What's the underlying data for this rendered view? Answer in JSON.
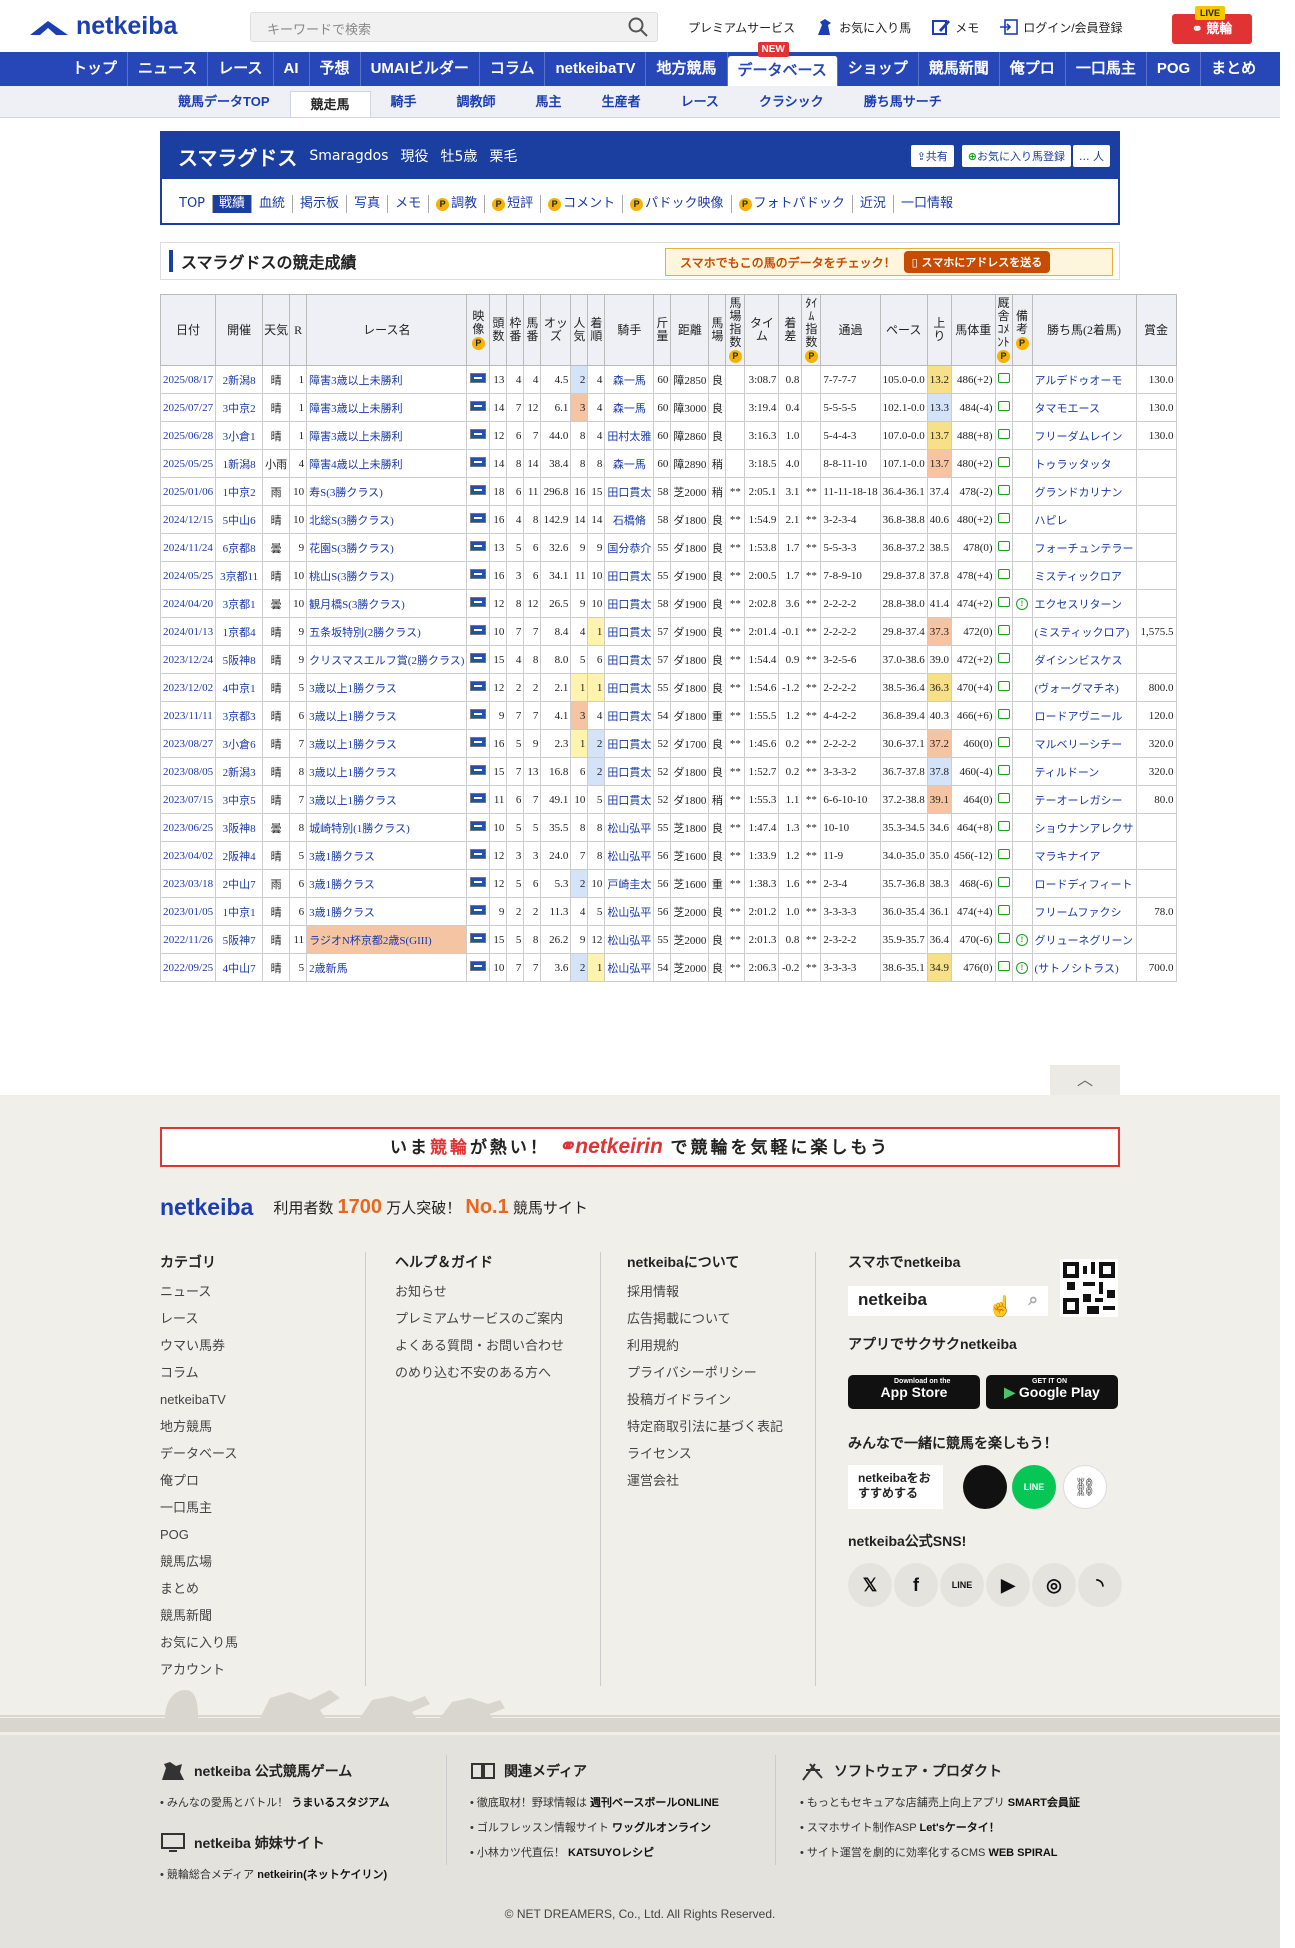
{
  "header": {
    "logo": "netkeiba",
    "search_placeholder": "キーワードで検索",
    "links": [
      "プレミアムサービス",
      "お気に入り馬",
      "メモ",
      "ログイン/会員登録"
    ],
    "live_badge": "LIVE",
    "live_label": "競輪"
  },
  "gnav": {
    "items": [
      "トップ",
      "ニュース",
      "レース",
      "AI",
      "予想",
      "UMAIビルダー",
      "コラム",
      "netkeibaTV",
      "地方競馬",
      "データベース",
      "ショップ",
      "競馬新聞",
      "俺プロ",
      "一口馬主",
      "POG",
      "まとめ"
    ],
    "new_badge": "NEW"
  },
  "snav": {
    "items": [
      "競馬データTOP",
      "競走馬",
      "騎手",
      "調教師",
      "馬主",
      "生産者",
      "レース",
      "クラシック",
      "勝ち馬サーチ"
    ]
  },
  "horse": {
    "name": "スマラグドス",
    "name_en": "Smaragdos",
    "status": "現役",
    "sex_age": "牡5歳",
    "color": "栗毛",
    "share": "共有",
    "fav": "お気に入り馬登録",
    "people": "... 人",
    "tabs": [
      "TOP",
      "戦績",
      "血統",
      "掲示板",
      "写真",
      "メモ",
      "調教",
      "短評",
      "コメント",
      "パドック映像",
      "フォトパドック",
      "近況",
      "一口情報"
    ]
  },
  "section": {
    "title": "スマラグドスの競走成績",
    "promo": "スマホでもこの馬のデータをチェック！",
    "promo_btn": "スマホにアドレスを送る"
  },
  "table": {
    "headers": [
      "日付",
      "開催",
      "天気",
      "R",
      "レース名",
      "映像",
      "頭数",
      "枠番",
      "馬番",
      "オッズ",
      "人気",
      "着順",
      "騎手",
      "斤量",
      "距離",
      "馬場",
      "馬場指数",
      "タイム",
      "着差",
      "ﾀｲﾑ指数",
      "通過",
      "ペース",
      "上り",
      "馬体重",
      "厩舎ｺﾒﾝﾄ",
      "備考",
      "勝ち馬(2着馬)",
      "賞金"
    ],
    "rows": [
      [
        "2025/08/17",
        "2新潟8",
        "晴",
        "1",
        "障害3歳以上未勝利",
        "13",
        "4",
        "4",
        "4.5",
        "2",
        "4",
        "森一馬",
        "60",
        "障2850",
        "良",
        "",
        "3:08.7",
        "0.8",
        "",
        "7-7-7-7",
        "105.0-0.0",
        "13.2",
        "486(+2)",
        "c",
        "",
        "アルデドゥオーモ",
        "130.0"
      ],
      [
        "2025/07/27",
        "3中京2",
        "晴",
        "1",
        "障害3歳以上未勝利",
        "14",
        "7",
        "12",
        "6.1",
        "3",
        "4",
        "森一馬",
        "60",
        "障3000",
        "良",
        "",
        "3:19.4",
        "0.4",
        "",
        "5-5-5-5",
        "102.1-0.0",
        "13.3",
        "484(-4)",
        "c",
        "",
        "タマモエース",
        "130.0"
      ],
      [
        "2025/06/28",
        "3小倉1",
        "晴",
        "1",
        "障害3歳以上未勝利",
        "12",
        "6",
        "7",
        "44.0",
        "8",
        "4",
        "田村太雅",
        "60",
        "障2860",
        "良",
        "",
        "3:16.3",
        "1.0",
        "",
        "5-4-4-3",
        "107.0-0.0",
        "13.7",
        "488(+8)",
        "c",
        "",
        "フリーダムレイン",
        "130.0"
      ],
      [
        "2025/05/25",
        "1新潟8",
        "小雨",
        "4",
        "障害4歳以上未勝利",
        "14",
        "8",
        "14",
        "38.4",
        "8",
        "8",
        "森一馬",
        "60",
        "障2890",
        "稍",
        "",
        "3:18.5",
        "4.0",
        "",
        "8-8-11-10",
        "107.1-0.0",
        "13.7",
        "480(+2)",
        "c",
        "",
        "トゥラッタッタ",
        ""
      ],
      [
        "2025/01/06",
        "1中京2",
        "雨",
        "10",
        "寿S(3勝クラス)",
        "18",
        "6",
        "11",
        "296.8",
        "16",
        "15",
        "田口貫太",
        "58",
        "芝2000",
        "稍",
        "**",
        "2:05.1",
        "3.1",
        "**",
        "11-11-18-18",
        "36.4-36.1",
        "37.4",
        "478(-2)",
        "c",
        "",
        "グランドカリナン",
        ""
      ],
      [
        "2024/12/15",
        "5中山6",
        "晴",
        "10",
        "北総S(3勝クラス)",
        "16",
        "4",
        "8",
        "142.9",
        "14",
        "14",
        "石橋脩",
        "58",
        "ダ1800",
        "良",
        "**",
        "1:54.9",
        "2.1",
        "**",
        "3-2-3-4",
        "36.8-38.8",
        "40.6",
        "480(+2)",
        "c",
        "",
        "ハピレ",
        ""
      ],
      [
        "2024/11/24",
        "6京都8",
        "曇",
        "9",
        "花園S(3勝クラス)",
        "13",
        "5",
        "6",
        "32.6",
        "9",
        "9",
        "国分恭介",
        "55",
        "ダ1800",
        "良",
        "**",
        "1:53.8",
        "1.7",
        "**",
        "5-5-3-3",
        "36.8-37.2",
        "38.5",
        "478(0)",
        "c",
        "",
        "フォーチュンテラー",
        ""
      ],
      [
        "2024/05/25",
        "3京都11",
        "晴",
        "10",
        "桃山S(3勝クラス)",
        "16",
        "3",
        "6",
        "34.1",
        "11",
        "10",
        "田口貫太",
        "55",
        "ダ1900",
        "良",
        "**",
        "2:00.5",
        "1.7",
        "**",
        "7-8-9-10",
        "29.8-37.8",
        "37.8",
        "478(+4)",
        "c",
        "",
        "ミスティックロア",
        ""
      ],
      [
        "2024/04/20",
        "3京都1",
        "曇",
        "10",
        "観月橋S(3勝クラス)",
        "12",
        "8",
        "12",
        "26.5",
        "9",
        "10",
        "田口貫太",
        "58",
        "ダ1900",
        "良",
        "**",
        "2:02.8",
        "3.6",
        "**",
        "2-2-2-2",
        "28.8-38.0",
        "41.4",
        "474(+2)",
        "c",
        "e",
        "エクセスリターン",
        ""
      ],
      [
        "2024/01/13",
        "1京都4",
        "晴",
        "9",
        "五条坂特別(2勝クラス)",
        "10",
        "7",
        "7",
        "8.4",
        "4",
        "1",
        "田口貫太",
        "57",
        "ダ1900",
        "良",
        "**",
        "2:01.4",
        "-0.1",
        "**",
        "2-2-2-2",
        "29.8-37.4",
        "37.3",
        "472(0)",
        "c",
        "",
        "(ミスティックロア)",
        "1,575.5"
      ],
      [
        "2023/12/24",
        "5阪神8",
        "晴",
        "9",
        "クリスマスエルフ賞(2勝クラス)",
        "15",
        "4",
        "8",
        "8.0",
        "5",
        "6",
        "田口貫太",
        "57",
        "ダ1800",
        "良",
        "**",
        "1:54.4",
        "0.9",
        "**",
        "3-2-5-6",
        "37.0-38.6",
        "39.0",
        "472(+2)",
        "c",
        "",
        "ダイシンビスケス",
        ""
      ],
      [
        "2023/12/02",
        "4中京1",
        "晴",
        "5",
        "3歳以上1勝クラス",
        "12",
        "2",
        "2",
        "2.1",
        "1",
        "1",
        "田口貫太",
        "55",
        "ダ1800",
        "良",
        "**",
        "1:54.6",
        "-1.2",
        "**",
        "2-2-2-2",
        "38.5-36.4",
        "36.3",
        "470(+4)",
        "c",
        "",
        "(ヴォーグマチネ)",
        "800.0"
      ],
      [
        "2023/11/11",
        "3京都3",
        "晴",
        "6",
        "3歳以上1勝クラス",
        "9",
        "7",
        "7",
        "4.1",
        "3",
        "4",
        "田口貫太",
        "54",
        "ダ1800",
        "重",
        "**",
        "1:55.5",
        "1.2",
        "**",
        "4-4-2-2",
        "36.8-39.4",
        "40.3",
        "466(+6)",
        "c",
        "",
        "ロードアヴニール",
        "120.0"
      ],
      [
        "2023/08/27",
        "3小倉6",
        "晴",
        "7",
        "3歳以上1勝クラス",
        "16",
        "5",
        "9",
        "2.3",
        "1",
        "2",
        "田口貫太",
        "52",
        "ダ1700",
        "良",
        "**",
        "1:45.6",
        "0.2",
        "**",
        "2-2-2-2",
        "30.6-37.1",
        "37.2",
        "460(0)",
        "c",
        "",
        "マルベリーシチー",
        "320.0"
      ],
      [
        "2023/08/05",
        "2新潟3",
        "晴",
        "8",
        "3歳以上1勝クラス",
        "15",
        "7",
        "13",
        "16.8",
        "6",
        "2",
        "田口貫太",
        "52",
        "ダ1800",
        "良",
        "**",
        "1:52.7",
        "0.2",
        "**",
        "3-3-3-2",
        "36.7-37.8",
        "37.8",
        "460(-4)",
        "c",
        "",
        "ティルドーン",
        "320.0"
      ],
      [
        "2023/07/15",
        "3中京5",
        "晴",
        "7",
        "3歳以上1勝クラス",
        "11",
        "6",
        "7",
        "49.1",
        "10",
        "5",
        "田口貫太",
        "52",
        "ダ1800",
        "稍",
        "**",
        "1:55.3",
        "1.1",
        "**",
        "6-6-10-10",
        "37.2-38.8",
        "39.1",
        "464(0)",
        "c",
        "",
        "テーオーレガシー",
        "80.0"
      ],
      [
        "2023/06/25",
        "3阪神8",
        "曇",
        "8",
        "城崎特別(1勝クラス)",
        "10",
        "5",
        "5",
        "35.5",
        "8",
        "8",
        "松山弘平",
        "55",
        "芝1800",
        "良",
        "**",
        "1:47.4",
        "1.3",
        "**",
        "10-10",
        "35.3-34.5",
        "34.6",
        "464(+8)",
        "c",
        "",
        "ショウナンアレクサ",
        ""
      ],
      [
        "2023/04/02",
        "2阪神4",
        "晴",
        "5",
        "3歳1勝クラス",
        "12",
        "3",
        "3",
        "24.0",
        "7",
        "8",
        "松山弘平",
        "56",
        "芝1600",
        "良",
        "**",
        "1:33.9",
        "1.2",
        "**",
        "11-9",
        "34.0-35.0",
        "35.0",
        "456(-12)",
        "c",
        "",
        "マラキナイア",
        ""
      ],
      [
        "2023/03/18",
        "2中山7",
        "雨",
        "6",
        "3歳1勝クラス",
        "12",
        "5",
        "6",
        "5.3",
        "2",
        "10",
        "戸崎圭太",
        "56",
        "芝1600",
        "重",
        "**",
        "1:38.3",
        "1.6",
        "**",
        "2-3-4",
        "35.7-36.8",
        "38.3",
        "468(-6)",
        "c",
        "",
        "ロードディフィート",
        ""
      ],
      [
        "2023/01/05",
        "1中京1",
        "晴",
        "6",
        "3歳1勝クラス",
        "9",
        "2",
        "2",
        "11.3",
        "4",
        "5",
        "松山弘平",
        "56",
        "芝2000",
        "良",
        "**",
        "2:01.2",
        "1.0",
        "**",
        "3-3-3-3",
        "36.0-35.4",
        "36.1",
        "474(+4)",
        "c",
        "",
        "フリームファクシ",
        "78.0"
      ],
      [
        "2022/11/26",
        "5阪神7",
        "晴",
        "11",
        "ラジオN杯京都2歳S(GIII)",
        "15",
        "5",
        "8",
        "26.2",
        "9",
        "12",
        "松山弘平",
        "55",
        "芝2000",
        "良",
        "**",
        "2:01.3",
        "0.8",
        "**",
        "2-3-2-2",
        "35.9-35.7",
        "36.4",
        "470(-6)",
        "c",
        "e",
        "グリューネグリーン",
        ""
      ],
      [
        "2022/09/25",
        "4中山7",
        "晴",
        "5",
        "2歳新馬",
        "10",
        "7",
        "7",
        "3.6",
        "2",
        "1",
        "松山弘平",
        "54",
        "芝2000",
        "良",
        "**",
        "2:06.3",
        "-0.2",
        "**",
        "3-3-3-3",
        "38.6-35.1",
        "34.9",
        "476(0)",
        "c",
        "e",
        "(サトノシトラス)",
        "700.0"
      ]
    ]
  },
  "footer": {
    "keirin_pre": "いま",
    "keirin_red": "競輪",
    "keirin_mid": "が熱い！",
    "keirin_logo": "netkeirin",
    "keirin_post": "で競輪を気軽に楽しもう",
    "brand": "netkeiba",
    "brand_pre": "利用者数",
    "brand_num": "1700",
    "brand_mid": "万人突破！",
    "brand_no1": "No.1",
    "brand_post": "競馬サイト",
    "col1": {
      "title": "カテゴリ",
      "items": [
        "ニュース",
        "レース",
        "ウマい馬券",
        "コラム",
        "netkeibaTV",
        "地方競馬",
        "データベース",
        "俺プロ",
        "一口馬主",
        "POG",
        "競馬広場",
        "まとめ",
        "競馬新聞",
        "お気に入り馬",
        "アカウント"
      ]
    },
    "col2": {
      "title": "ヘルプ＆ガイド",
      "items": [
        "お知らせ",
        "プレミアムサービスのご案内",
        "よくある質問・お問い合わせ",
        "のめり込む不安のある方へ"
      ]
    },
    "col3": {
      "title": "netkeibaについて",
      "items": [
        "採用情報",
        "広告掲載について",
        "利用規約",
        "プライバシーポリシー",
        "投稿ガイドライン",
        "特定商取引法に基づく表記",
        "ライセンス",
        "運営会社"
      ]
    },
    "col4": {
      "title": "スマホでnetkeiba",
      "search": "netkeiba",
      "app_title": "アプリでサクサクnetkeiba",
      "appstore": "App Store",
      "appstore_small": "Download on the",
      "googleplay": "Google Play",
      "googleplay_small": "GET IT ON",
      "share_title": "みんなで一緒に競馬を楽しもう！",
      "recommend": "netkeibaをおすすめする",
      "line": "LINE",
      "sns_title": "netkeiba公式SNS!"
    },
    "lower": {
      "game_title": "netkeiba 公式競馬ゲーム",
      "game_item": "みんなの愛馬とバトル！",
      "game_item_b": "うまいるスタジアム",
      "sister_title": "netkeiba 姉妹サイト",
      "sister_item": "競輪総合メディア",
      "sister_item_b": "netkeirin(ネットケイリン)",
      "media_title": "関連メディア",
      "media_items": [
        [
          "徹底取材！野球情報は",
          "週刊ベースボールONLINE"
        ],
        [
          "ゴルフレッスン情報サイト",
          "ワッグルオンライン"
        ],
        [
          "小林カツ代直伝！",
          "KATSUYOレシピ"
        ]
      ],
      "soft_title": "ソフトウェア・プロダクト",
      "soft_items": [
        [
          "もっともセキュアな店舗売上向上アプリ",
          "SMART会員証"
        ],
        [
          "スマホサイト制作ASP",
          "Let'sケータイ！"
        ],
        [
          "サイト運営を劇的に効率化するCMS",
          "WEB SPIRAL"
        ]
      ],
      "copyright": "© NET DREAMERS, Co., Ltd. All Rights Reserved."
    }
  }
}
